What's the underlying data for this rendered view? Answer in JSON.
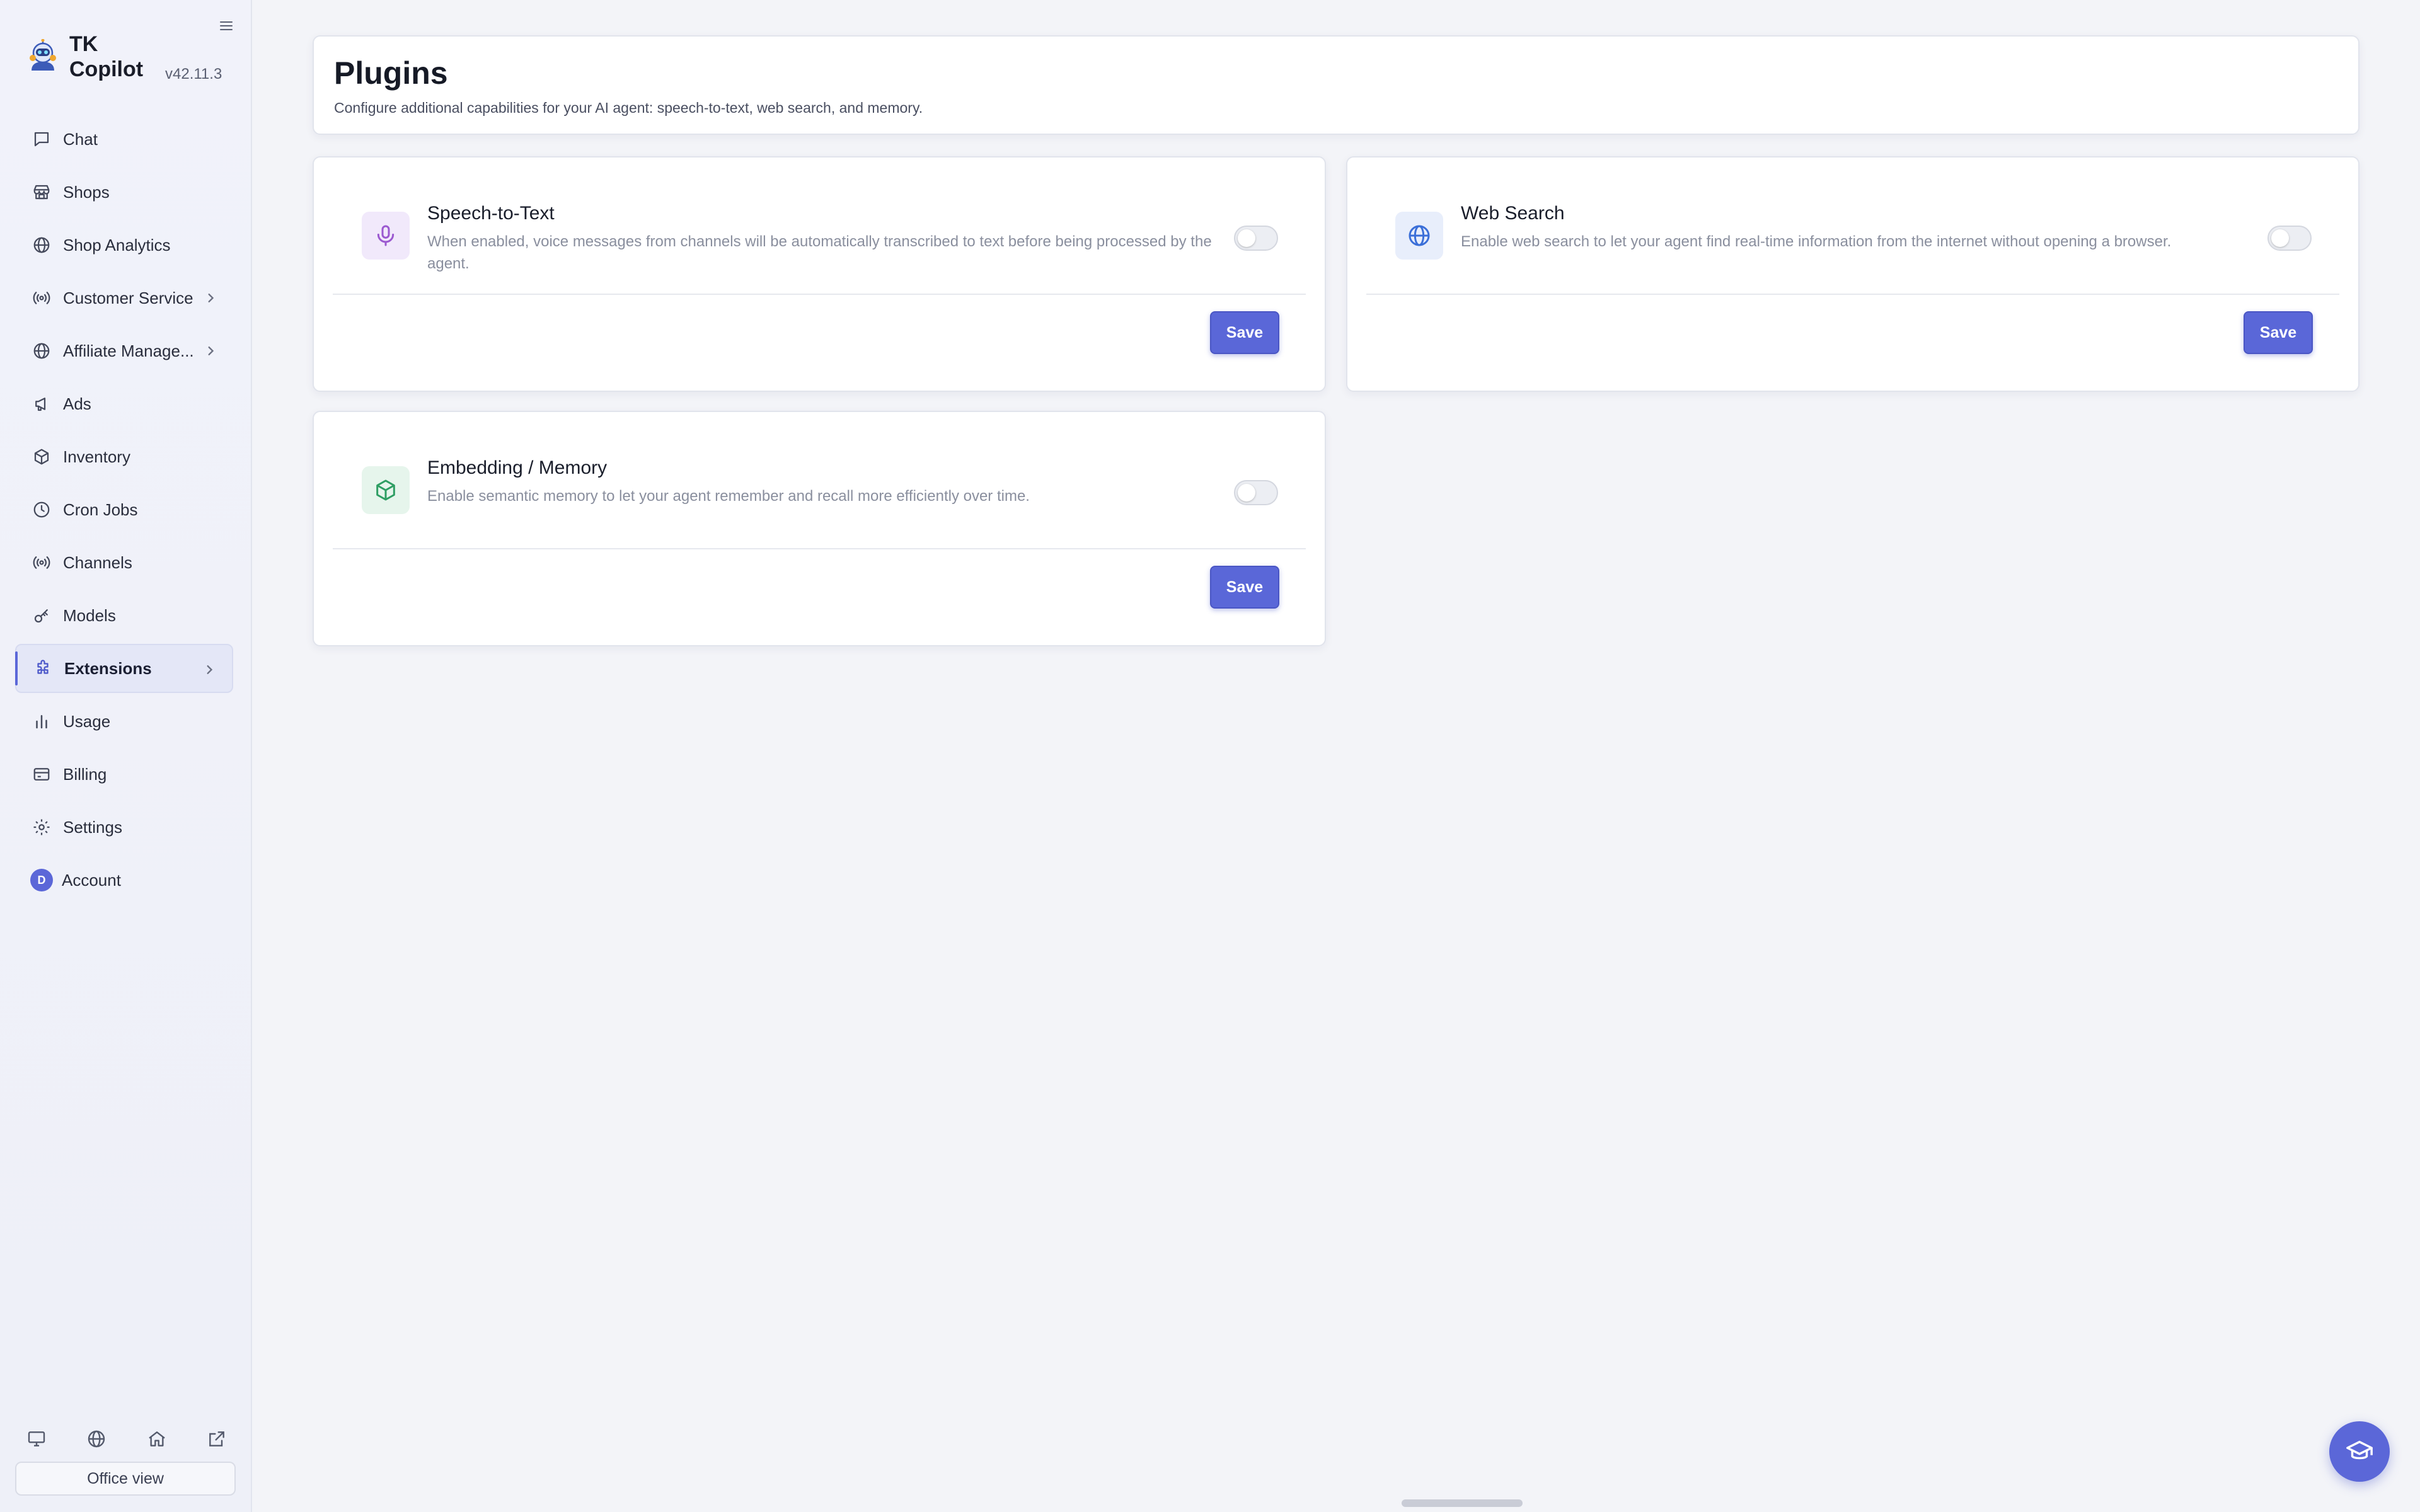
{
  "brand": {
    "name_line1": "TK",
    "name_line2": "Copilot",
    "version": "v42.11.3"
  },
  "sidebar": {
    "items": [
      {
        "label": "Chat",
        "icon": "chat-icon"
      },
      {
        "label": "Shops",
        "icon": "store-icon"
      },
      {
        "label": "Shop Analytics",
        "icon": "globe-icon"
      },
      {
        "label": "Customer Service",
        "icon": "broadcast-icon",
        "has_submenu": true
      },
      {
        "label": "Affiliate Manage...",
        "icon": "globe-icon",
        "has_submenu": true
      },
      {
        "label": "Ads",
        "icon": "megaphone-icon"
      },
      {
        "label": "Inventory",
        "icon": "box-icon"
      },
      {
        "label": "Cron Jobs",
        "icon": "clock-icon"
      },
      {
        "label": "Channels",
        "icon": "broadcast-icon"
      },
      {
        "label": "Models",
        "icon": "key-icon"
      },
      {
        "label": "Extensions",
        "icon": "puzzle-icon",
        "has_submenu": true,
        "active": true
      },
      {
        "label": "Usage",
        "icon": "bar-chart-icon"
      },
      {
        "label": "Billing",
        "icon": "credit-card-icon"
      },
      {
        "label": "Settings",
        "icon": "gear-icon"
      },
      {
        "label": "Account",
        "icon": "avatar",
        "avatar_initial": "D"
      }
    ],
    "footer_icons": [
      "monitor-icon",
      "globe-icon",
      "home-icon",
      "external-link-icon"
    ],
    "office_view_label": "Office view"
  },
  "header": {
    "title": "Plugins",
    "subtitle": "Configure additional capabilities for your AI agent: speech-to-text, web search, and memory."
  },
  "plugins": [
    {
      "title": "Speech-to-Text",
      "description": "When enabled, voice messages from channels will be automatically transcribed to text before being processed by the agent.",
      "icon": "microphone-icon",
      "enabled": false,
      "save_label": "Save"
    },
    {
      "title": "Web Search",
      "description": "Enable web search to let your agent find real-time information from the internet without opening a browser.",
      "icon": "globe-icon",
      "enabled": false,
      "save_label": "Save"
    },
    {
      "title": "Embedding / Memory",
      "description": "Enable semantic memory to let your agent remember and recall more efficiently over time.",
      "icon": "cube-icon",
      "enabled": false,
      "save_label": "Save"
    }
  ],
  "colors": {
    "accent": "#5a67d8",
    "speech_icon_bg": "#f1e9fb",
    "speech_icon": "#9b59d0",
    "web_icon_bg": "#e8eefb",
    "web_icon": "#3b6fd8",
    "memory_icon_bg": "#e6f5ec",
    "memory_icon": "#2e9e63"
  }
}
